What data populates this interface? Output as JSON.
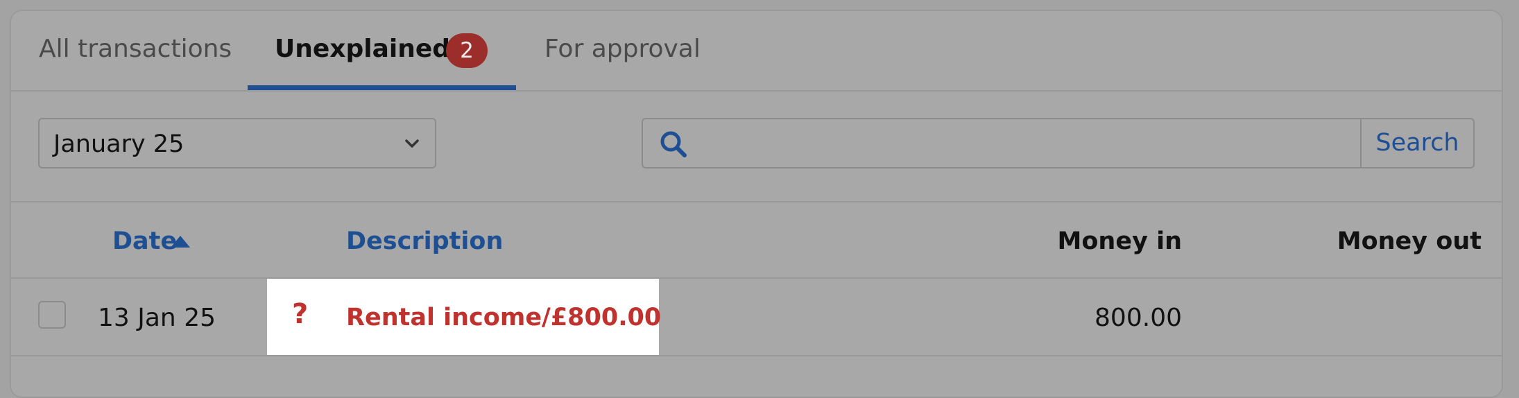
{
  "tabs": {
    "all": "All transactions",
    "unexplained": "Unexplained",
    "unexplained_count": "2",
    "approval": "For approval"
  },
  "filters": {
    "period": "January 25",
    "search_placeholder": "",
    "search_button": "Search"
  },
  "table": {
    "headers": {
      "date": "Date",
      "description": "Description",
      "money_in": "Money in",
      "money_out": "Money out"
    },
    "rows": [
      {
        "date": "13 Jan 25",
        "status_icon": "question-icon",
        "description": "Rental income/£800.00",
        "money_in": "800.00",
        "money_out": ""
      }
    ]
  },
  "colors": {
    "accent": "#1f4f93",
    "alert": "#c0322d",
    "badge": "#9b2e2b",
    "overlay_bg": "#a8a8a8",
    "highlight_bg": "#ffffff"
  }
}
